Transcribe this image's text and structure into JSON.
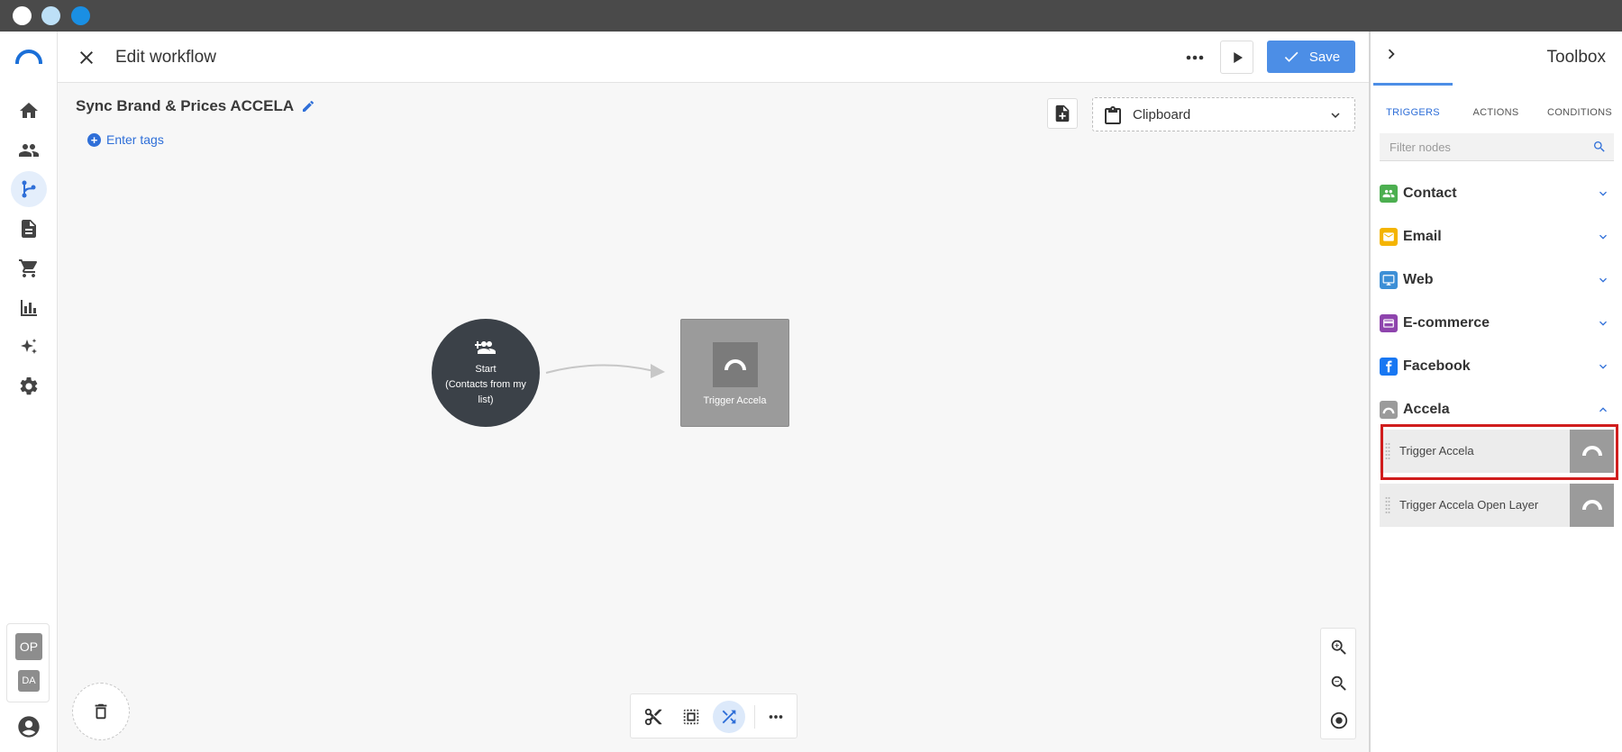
{
  "colors": {
    "accent": "#2f6fd8",
    "save_button": "#4c8ee6",
    "start_node": "#3b4148",
    "accela_gray": "#9b9b9b",
    "contact": "#4caf50",
    "email": "#f4b400",
    "web": "#3d8fd6",
    "ecommerce": "#8e44ad",
    "facebook": "#1877f2",
    "highlight": "#d01d1d"
  },
  "header": {
    "title": "Edit workflow",
    "save_label": "Save"
  },
  "canvas": {
    "workflow_name": "Sync Brand & Prices ACCELA",
    "tags_label": "Enter tags",
    "clipboard_label": "Clipboard",
    "start_node": {
      "label_line1": "Start",
      "label_line2": "(Contacts from my",
      "label_line3": "list)"
    },
    "trigger_node": {
      "label": "Trigger Accela"
    }
  },
  "account": {
    "primary_initials": "OP",
    "secondary_initials": "DA"
  },
  "toolbox": {
    "title": "Toolbox",
    "tabs": [
      "TRIGGERS",
      "ACTIONS",
      "CONDITIONS"
    ],
    "filter_placeholder": "Filter nodes",
    "categories": [
      {
        "label": "Contact",
        "icon": "people-icon",
        "expanded": false
      },
      {
        "label": "Email",
        "icon": "envelope-icon",
        "expanded": false
      },
      {
        "label": "Web",
        "icon": "monitor-icon",
        "expanded": false
      },
      {
        "label": "E-commerce",
        "icon": "card-icon",
        "expanded": false
      },
      {
        "label": "Facebook",
        "icon": "facebook-icon",
        "expanded": false
      },
      {
        "label": "Accela",
        "icon": "accela-icon",
        "expanded": true
      }
    ],
    "accela_nodes": [
      {
        "label": "Trigger Accela",
        "highlighted": true
      },
      {
        "label": "Trigger Accela Open Layer",
        "highlighted": false
      }
    ]
  }
}
